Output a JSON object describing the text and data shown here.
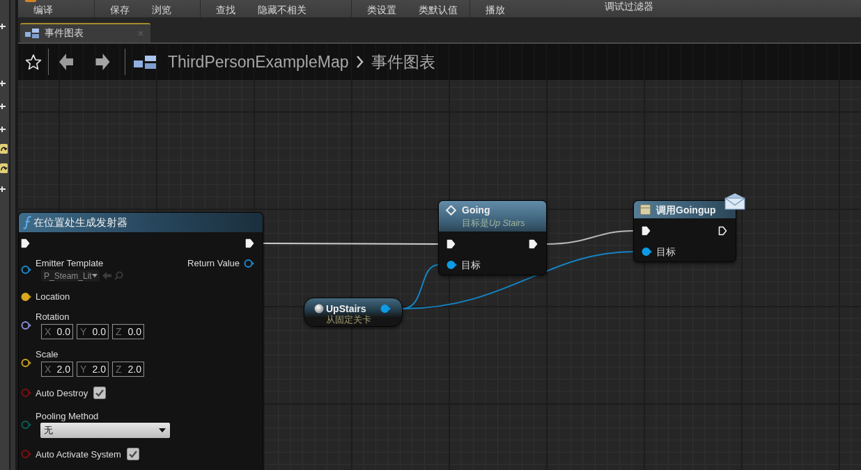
{
  "toolbar": {
    "groups": [
      {
        "buttons": [
          {
            "label": "编译"
          }
        ]
      },
      {
        "buttons": [
          {
            "label": "保存"
          },
          {
            "label": "浏览"
          }
        ]
      },
      {
        "buttons": [
          {
            "label": "查找"
          },
          {
            "label": "隐藏不相关"
          }
        ]
      },
      {
        "buttons": [
          {
            "label": "类设置"
          },
          {
            "label": "类默认值"
          }
        ]
      },
      {
        "buttons": [
          {
            "label": "播放"
          }
        ]
      }
    ],
    "debug_filter": {
      "label": "调试过滤器"
    }
  },
  "tabs": [
    {
      "label": "事件图表",
      "selected": true
    }
  ],
  "breadcrumb": {
    "items": [
      "ThirdPersonExampleMap",
      "事件图表"
    ]
  },
  "graph": {
    "nodes": [
      {
        "kind": "function_call",
        "title": "在位置处生成发射器",
        "rows": [
          {
            "kind": "exec",
            "in_filled": true,
            "out_filled": true
          },
          {
            "kind": "asset",
            "label": "Emitter Template",
            "color": "#1a8ad0",
            "filled": false,
            "value": "P_Steam_Lit",
            "output": {
              "label": "Return Value",
              "color": "#1a8ad0",
              "filled": false
            }
          },
          {
            "kind": "plain",
            "label": "Location",
            "color": "#d9a81e",
            "filled": true
          },
          {
            "kind": "vector",
            "label": "Rotation",
            "color": "#8a8fd6",
            "filled": false,
            "fields": [
              {
                "axis": "X",
                "value": "0.0"
              },
              {
                "axis": "Y",
                "value": "0.0"
              },
              {
                "axis": "Z",
                "value": "0.0"
              }
            ]
          },
          {
            "kind": "vector",
            "label": "Scale",
            "color": "#c9a119",
            "filled": false,
            "fields": [
              {
                "axis": "X",
                "value": "2.0"
              },
              {
                "axis": "Y",
                "value": "2.0"
              },
              {
                "axis": "Z",
                "value": "2.0"
              }
            ]
          },
          {
            "kind": "checkbox",
            "label": "Auto Destroy",
            "color": "#7e1010",
            "filled": false,
            "checked": true
          },
          {
            "kind": "dropdown",
            "label": "Pooling Method",
            "color": "#0c5e55",
            "filled": false,
            "value": "无"
          },
          {
            "kind": "checkbox",
            "label": "Auto Activate System",
            "color": "#7e1010",
            "filled": false,
            "checked": true
          }
        ]
      },
      {
        "kind": "event_call",
        "title": "Going",
        "subtitle": "目标是",
        "subtitle_emphasis": "Up Stairs",
        "rows": [
          {
            "kind": "exec",
            "in_filled": true,
            "out_filled": true
          },
          {
            "kind": "plain",
            "label": "目标",
            "color": "#0e9be6",
            "filled": true
          }
        ]
      },
      {
        "kind": "variable",
        "title": "UpStairs",
        "subtitle": "从固定关卡",
        "output": {
          "color": "#0e9be6",
          "filled": true
        }
      },
      {
        "kind": "message_call",
        "title": "调用Goingup",
        "rows": [
          {
            "kind": "exec",
            "in_filled": true,
            "out_filled": false
          },
          {
            "kind": "plain",
            "label": "目标",
            "color": "#0e9be6",
            "filled": true
          }
        ]
      }
    ]
  }
}
